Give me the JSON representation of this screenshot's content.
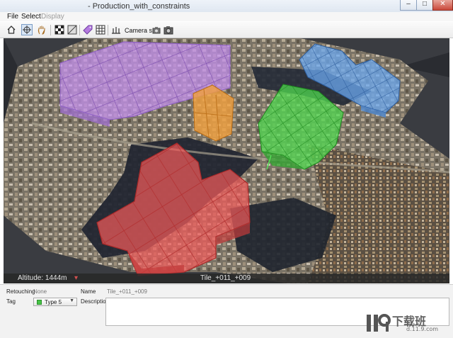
{
  "window": {
    "title": "- Production_with_constraints",
    "minimize_glyph": "–",
    "maximize_glyph": "□",
    "close_glyph": "✕"
  },
  "menu": {
    "items": [
      {
        "label": "File",
        "enabled": true
      },
      {
        "label": "Select",
        "enabled": true
      },
      {
        "label": "Display",
        "enabled": false
      }
    ]
  },
  "toolbar": {
    "camera_size_label": "Camera size",
    "icons": [
      "home-icon",
      "select-icon",
      "pan-hand-icon",
      "checker-icon",
      "texture-icon",
      "tag-icon",
      "grid-icon",
      "level-icon",
      "camera-icon",
      "camera-large-icon"
    ]
  },
  "status": {
    "altitude": "Altitude: 1444m",
    "tile": "Tile_+011_+009"
  },
  "panel": {
    "retouching_label": "Retouching",
    "retouching_value": "None",
    "name_label": "Name",
    "name_value": "Tile_+011_+009",
    "tag_label": "Tag",
    "tag_value": "Type 5",
    "tag_color": "#47c447",
    "description_label": "Description",
    "description_value": ""
  },
  "watermark": {
    "text": "下载班",
    "site": "d.11.9.com"
  },
  "colors": {
    "purple_tiles": "#c38cf0",
    "orange_tiles": "#f0a040",
    "green_tiles": "#49d849",
    "blue_tiles": "#6aa8f0",
    "red_tiles": "#f05050"
  }
}
